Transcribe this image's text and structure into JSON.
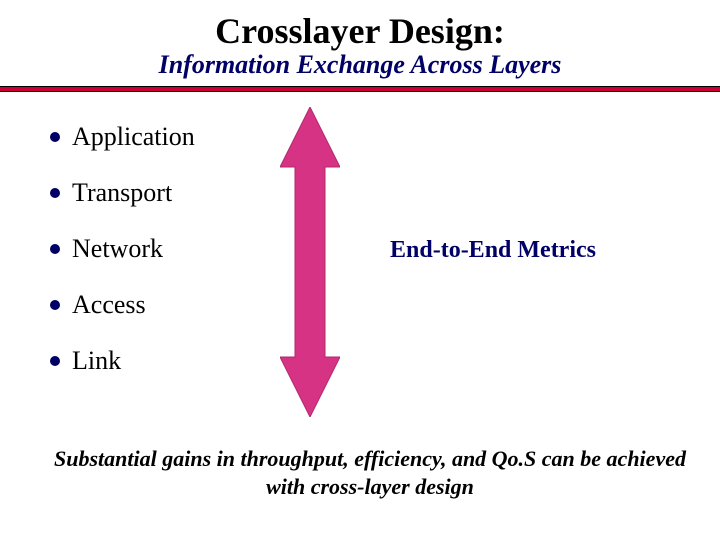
{
  "header": {
    "title": "Crosslayer Design:",
    "subtitle": "Information Exchange Across Layers"
  },
  "bullets": [
    "Application",
    "Transport",
    "Network",
    "Access",
    "Link"
  ],
  "arrow": {
    "name": "double-headed-arrow",
    "fill": "#d63384",
    "stroke": "#b02a6f"
  },
  "metrics_label": "End-to-End Metrics",
  "footer_text": "Substantial gains in throughput, efficiency, and Qo.S can be achieved with cross-layer design",
  "colors": {
    "accent_red": "#cc0033",
    "accent_navy": "#000066"
  }
}
